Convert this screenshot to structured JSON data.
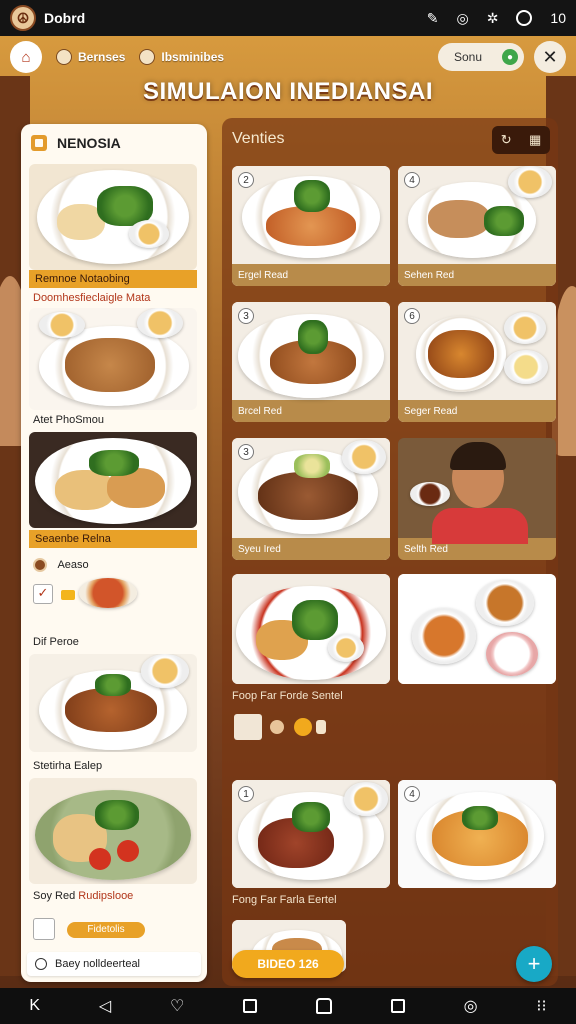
{
  "status_bar": {
    "app_name": "Dobrd",
    "right_text": "10",
    "icons": [
      "pen-icon",
      "target-icon",
      "settings-icon",
      "circle-icon"
    ]
  },
  "header": {
    "chip1_label": "Bernses",
    "chip2_label": "Ibsminibes",
    "search_label": "Sonu",
    "title": "SIMULAION INEDIANSAI"
  },
  "left_panel": {
    "title": "NENOSIA",
    "items": [
      {
        "label": "Remnoe Notaobing",
        "sub": "Doomhesfieclaigle Mata"
      },
      {
        "label": "Atet PhoSmou"
      },
      {
        "label": "Seaenbe Relna"
      },
      {
        "label": "Aeaso"
      },
      {
        "label": "Dif Peroe"
      },
      {
        "label": "Stetirha Ealep"
      },
      {
        "label": "Soy Red",
        "accent": "Rudipslooe"
      }
    ],
    "badge": "Fidetolis",
    "bottom_text": "Baey nolldeerteal"
  },
  "right_panel": {
    "title": "Venties",
    "cards": [
      {
        "num": "2",
        "label": "Ergel Read"
      },
      {
        "num": "4",
        "label": "Sehen Red"
      },
      {
        "num": "3",
        "label": "Brcel Red"
      },
      {
        "num": "6",
        "label": "Seger Read"
      },
      {
        "num": "3",
        "label": "Syeu Ired"
      },
      {
        "num": "",
        "label": "Selth Red"
      },
      {
        "num": "",
        "label": ""
      },
      {
        "num": "",
        "label": ""
      },
      {
        "num": "1",
        "label": ""
      },
      {
        "num": "4",
        "label": ""
      }
    ],
    "mid_text": "Foop Far Forde Sentel",
    "bottom_text": "Fong Far Farla Eertel",
    "order_button": "BIDEO 126"
  },
  "colors": {
    "accent": "#e8a128",
    "fab": "#18a9c6",
    "panel": "#fffaf1"
  }
}
